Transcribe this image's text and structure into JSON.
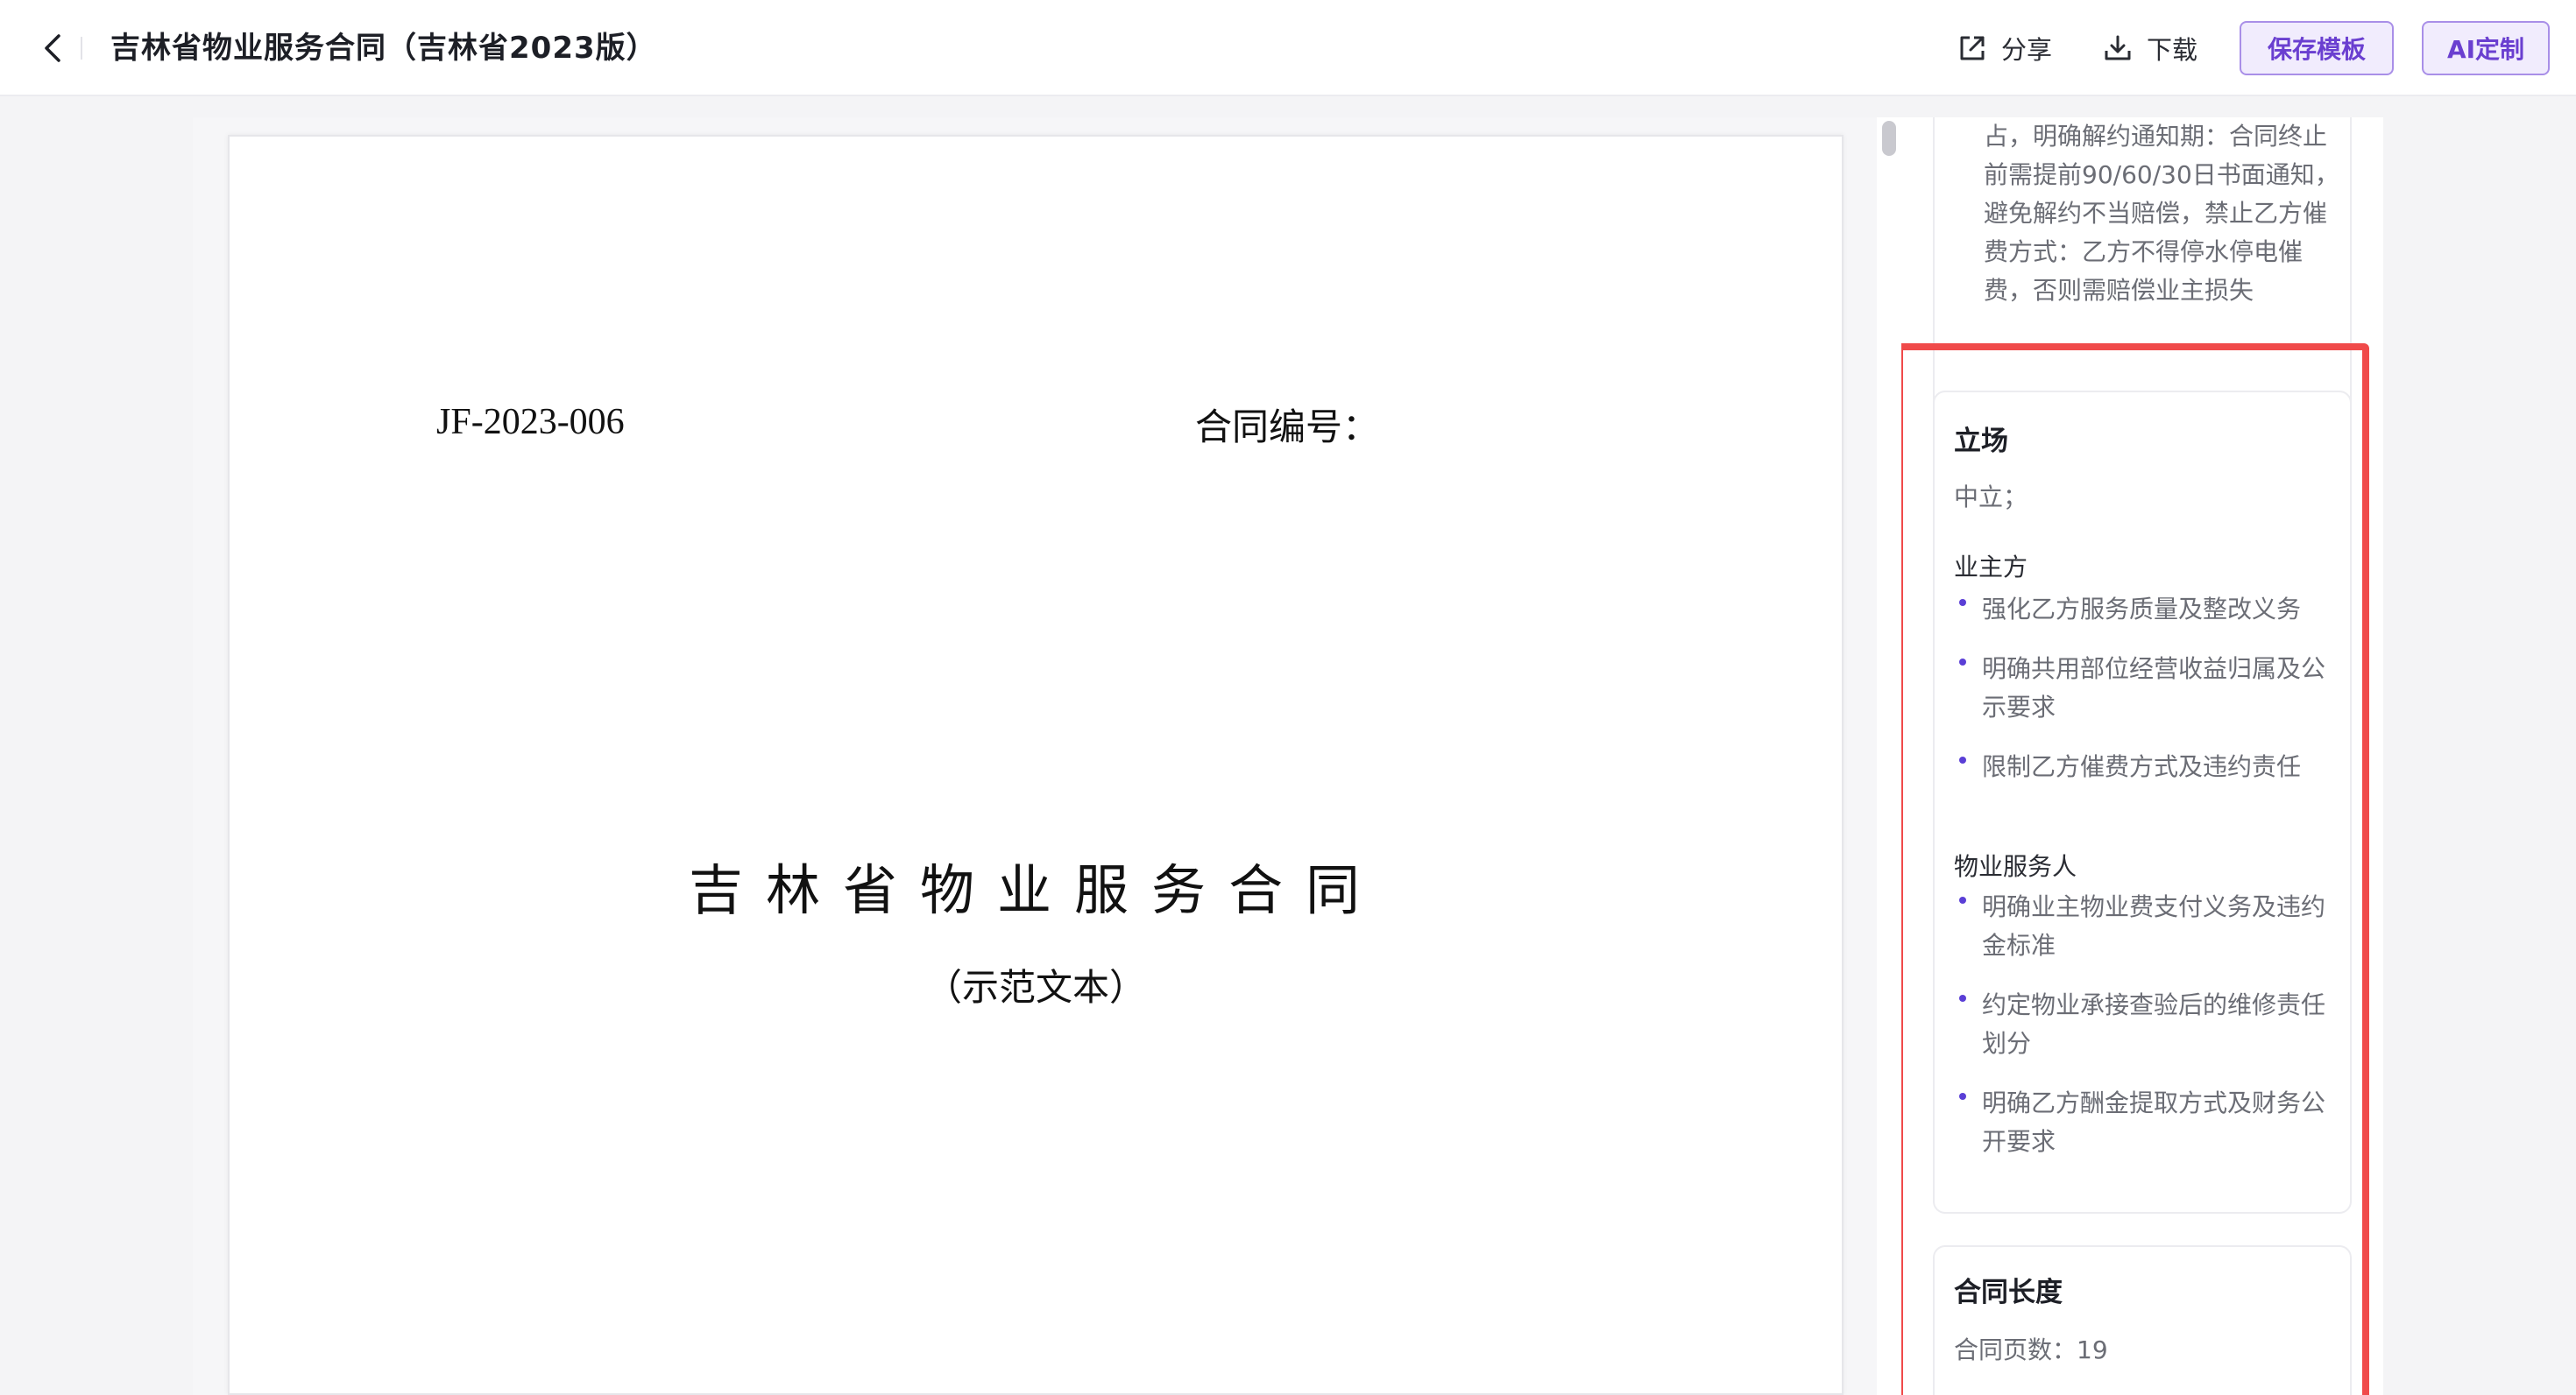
{
  "header": {
    "title": "吉林省物业服务合同（吉林省2023版）",
    "share_label": "分享",
    "download_label": "下载",
    "save_template_label": "保存模板",
    "ai_custom_label": "AI定制"
  },
  "document": {
    "contract_code": "JF-2023-006",
    "contract_no_label": "合同编号：",
    "contract_title": "吉林省物业服务合同",
    "contract_subtitle": "（示范文本）"
  },
  "side_panel": {
    "prev_card_text": "占，明确解约通知期：合同终止前需提前90/60/30日书面通知，避免解约不当赔偿，禁止乙方催费方式：乙方不得停水停电催费，否则需赔偿业主损失",
    "stance": {
      "title": "立场",
      "value": "中立；",
      "owner": {
        "title": "业主方",
        "points": [
          "强化乙方服务质量及整改义务",
          "明确共用部位经营收益归属及公示要求",
          "限制乙方催费方式及违约责任"
        ]
      },
      "manager": {
        "title": "物业服务人",
        "points": [
          "明确业主物业费支付义务及违约金标准",
          "约定物业承接查验后的维修责任划分",
          "明确乙方酬金提取方式及财务公开要求"
        ]
      }
    },
    "length": {
      "title": "合同长度",
      "page_count": "合同页数：19"
    }
  },
  "colors": {
    "accent": "#6a3fd0",
    "accent_bg": "#f1ecfd",
    "highlight": "#f04a4a",
    "bullet": "#5a3fd6"
  },
  "icons": {
    "back": "chevron-left-icon",
    "share": "share-icon",
    "download": "download-icon"
  }
}
